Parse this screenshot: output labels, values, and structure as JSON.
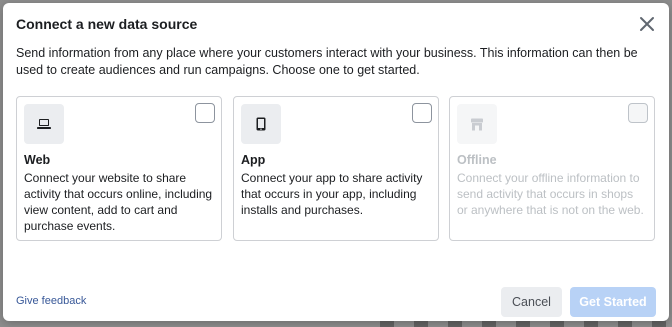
{
  "dialog": {
    "title": "Connect a new data source",
    "description": "Send information from any place where your customers interact with your business. This information can then be used to create audiences and run campaigns. Choose one to get started."
  },
  "cards": [
    {
      "icon": "laptop-icon",
      "name": "Web",
      "body": "Connect your website to share activity that occurs online, including view content, add to cart and purchase events.",
      "disabled": false
    },
    {
      "icon": "mobile-phone-icon",
      "name": "App",
      "body": "Connect your app to share activity that occurs in your app, including installs and purchases.",
      "disabled": false
    },
    {
      "icon": "store-icon",
      "name": "Offline",
      "body": "Connect your offline information to send activity that occurs in shops or anywhere that is not on the web.",
      "disabled": true
    }
  ],
  "footer": {
    "feedback_label": "Give feedback",
    "cancel_label": "Cancel",
    "primary_label": "Get Started",
    "primary_disabled": true
  },
  "colors": {
    "link": "#385898",
    "primary_disabled": "#b8d2f6",
    "border": "#ced0d4"
  }
}
